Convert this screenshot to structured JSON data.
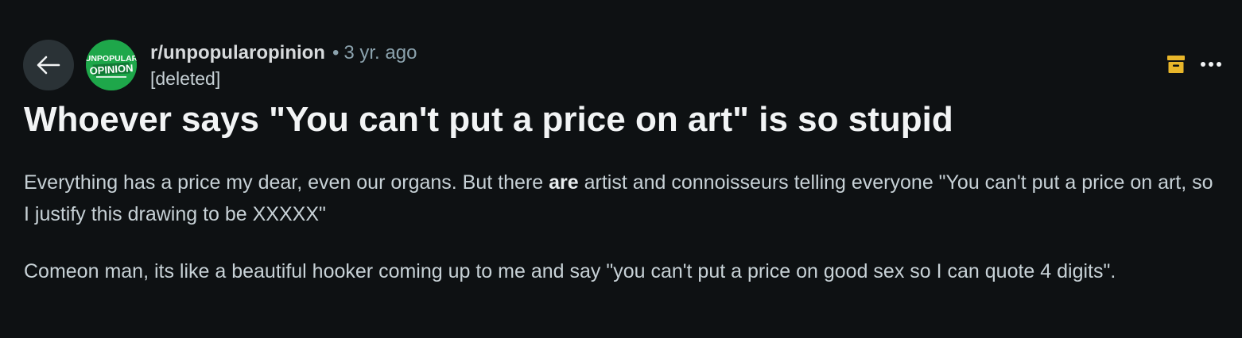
{
  "header": {
    "back_icon": "arrow-left-icon",
    "community": "r/unpopularopinion",
    "separator": "•",
    "age": "3 yr. ago",
    "author": "[deleted]",
    "avatar_icon": "unpopular-opinion-logo",
    "avatar_logo_text": [
      "UNPOPULAR",
      "OPINION"
    ],
    "archive_icon": "archive-icon",
    "more_icon": "more-horizontal-icon"
  },
  "post": {
    "title": "Whoever says \"You can't put a price on art\" is so stupid",
    "paragraph1": {
      "before": "Everything has a price my dear, even our organs. But there ",
      "bold": "are",
      "after": " artist and connoisseurs telling everyone \"You can't put a price on art, so I justify this drawing to be XXXXX\""
    },
    "paragraph2": "Comeon man, its like a beautiful hooker coming up to me and say \"you can't put a price on good sex so I can quote 4 digits\"."
  },
  "colors": {
    "background": "#0e1113",
    "archive_accent": "#e8b62a",
    "avatar_green": "#1ea74a"
  }
}
